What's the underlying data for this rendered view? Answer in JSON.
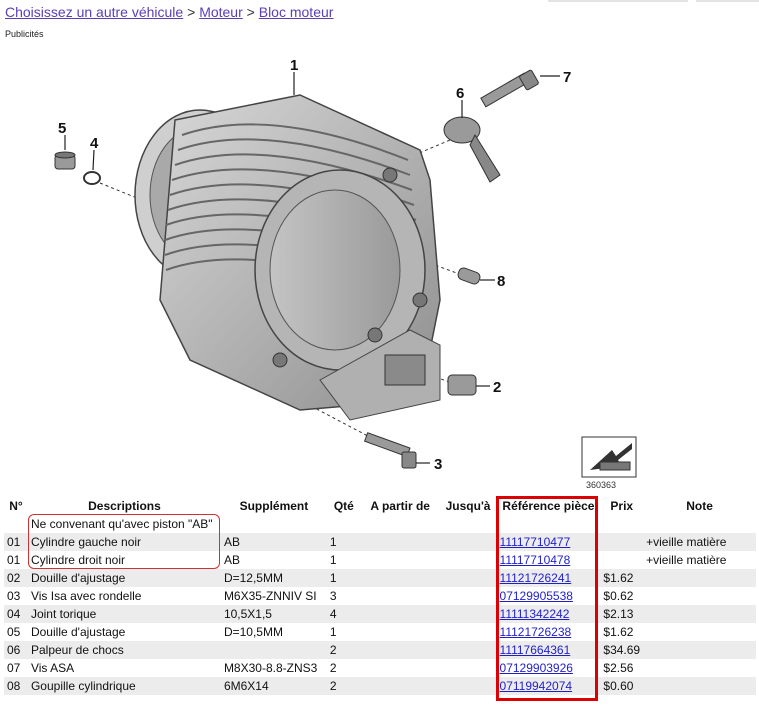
{
  "breadcrumb": {
    "link1": "Choisissez un autre véhicule",
    "sep1": " > ",
    "link2": "Moteur",
    "sep2": " > ",
    "link3": "Bloc moteur"
  },
  "ads_label": "Publicités",
  "diagram": {
    "callouts": [
      "1",
      "2",
      "3",
      "4",
      "5",
      "6",
      "7",
      "8"
    ],
    "image_number": "360363"
  },
  "table": {
    "headers": [
      "N°",
      "Descriptions",
      "Supplément",
      "Qté",
      "A partir de",
      "Jusqu'à",
      "Référence pièce",
      "Prix",
      "Note"
    ],
    "rows": [
      {
        "no": "",
        "desc": "Ne convenant qu'avec piston \"AB\"",
        "supp": "",
        "qty": "",
        "from": "",
        "to": "",
        "ref": "",
        "price": "",
        "note": ""
      },
      {
        "no": "01",
        "desc": "Cylindre gauche noir",
        "supp": "AB",
        "qty": "1",
        "from": "",
        "to": "",
        "ref": "11117710477",
        "price": "",
        "note": "+vieille matière"
      },
      {
        "no": "01",
        "desc": "Cylindre droit noir",
        "supp": "AB",
        "qty": "1",
        "from": "",
        "to": "",
        "ref": "11117710478",
        "price": "",
        "note": "+vieille matière"
      },
      {
        "no": "02",
        "desc": "Douille d'ajustage",
        "supp": "D=12,5MM",
        "qty": "1",
        "from": "",
        "to": "",
        "ref": "11121726241",
        "price": "$1.62",
        "note": ""
      },
      {
        "no": "03",
        "desc": "Vis Isa avec rondelle",
        "supp": "M6X35-ZNNIV SI",
        "qty": "3",
        "from": "",
        "to": "",
        "ref": "07129905538",
        "price": "$0.62",
        "note": ""
      },
      {
        "no": "04",
        "desc": "Joint torique",
        "supp": "10,5X1,5",
        "qty": "4",
        "from": "",
        "to": "",
        "ref": "11111342242",
        "price": "$2.13",
        "note": ""
      },
      {
        "no": "05",
        "desc": "Douille d'ajustage",
        "supp": "D=10,5MM",
        "qty": "1",
        "from": "",
        "to": "",
        "ref": "11121726238",
        "price": "$1.62",
        "note": ""
      },
      {
        "no": "06",
        "desc": "Palpeur de chocs",
        "supp": "",
        "qty": "2",
        "from": "",
        "to": "",
        "ref": "11117664361",
        "price": "$34.69",
        "note": ""
      },
      {
        "no": "07",
        "desc": "Vis ASA",
        "supp": "M8X30-8.8-ZNS3",
        "qty": "2",
        "from": "",
        "to": "",
        "ref": "07129903926",
        "price": "$2.56",
        "note": ""
      },
      {
        "no": "08",
        "desc": "Goupille cylindrique",
        "supp": "6M6X14",
        "qty": "2",
        "from": "",
        "to": "",
        "ref": "07119942074",
        "price": "$0.60",
        "note": ""
      }
    ]
  }
}
